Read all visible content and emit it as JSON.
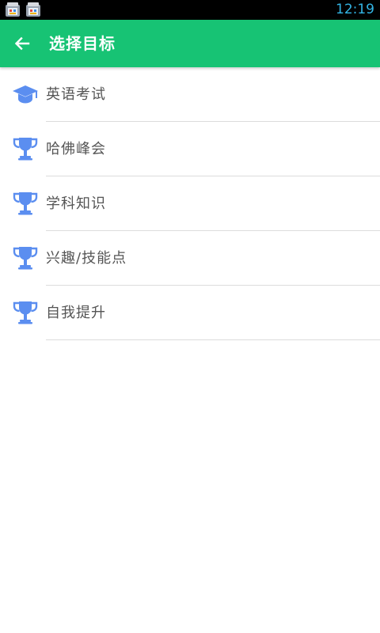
{
  "status_bar": {
    "time": "12:19",
    "time_color": "#33b5e5",
    "notification_icons": [
      "store-notification-icon",
      "store-notification-icon"
    ]
  },
  "app_bar": {
    "title": "选择目标",
    "background": "#17c374",
    "back_icon": "arrow-left-icon"
  },
  "goals": [
    {
      "label": "英语考试",
      "icon": "graduation-cap-icon"
    },
    {
      "label": "哈佛峰会",
      "icon": "trophy-icon"
    },
    {
      "label": "学科知识",
      "icon": "trophy-icon"
    },
    {
      "label": "兴趣/技能点",
      "icon": "trophy-icon"
    },
    {
      "label": "自我提升",
      "icon": "trophy-icon"
    }
  ],
  "icon_color": "#5b8ef0"
}
